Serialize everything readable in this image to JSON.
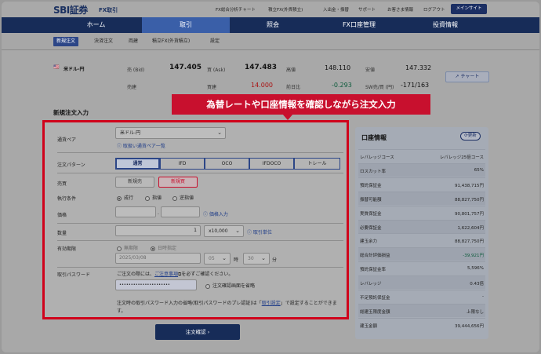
{
  "header": {
    "logo": "SBI証券",
    "logo_sub": "FX取引",
    "links": [
      "FX総合分析チャート",
      "積立FX(外貨積立)",
      "入出金・振替",
      "サポート",
      "お客さま情報",
      "ログアウト"
    ],
    "mainsite": "メインサイト"
  },
  "nav": {
    "items": [
      "ホーム",
      "取引",
      "照会",
      "FX口座管理",
      "投資情報"
    ],
    "active": "取引"
  },
  "subnav": {
    "items": [
      "新規注文",
      "決済注文",
      "両建",
      "積立FX(外貨積立)",
      "設定"
    ],
    "active": "新規注文"
  },
  "rates": {
    "pair": "米ドル-円",
    "bid_label": "売 (Bid)",
    "bid": "147.405",
    "ask_label": "買 (Ask)",
    "ask": "147.483",
    "high_label": "高値",
    "high": "148.110",
    "low_label": "安値",
    "low": "147.332",
    "sell_swap_label": "売建",
    "buy_swap_label": "買建",
    "buy_swap": "14.000",
    "prev_label": "前日比",
    "prev": "-0.293",
    "sw_label": "SW売/買 (円)",
    "sw": "-171/163",
    "chart_button": "チャート"
  },
  "section_title": "新規注文入力",
  "callout": "為替レートや口座情報を確認しながら注文入力",
  "form": {
    "pair_label": "通貨ペア",
    "pair_value": "米ドル-円",
    "pair_list_link": "取扱い通貨ペア一覧",
    "pattern_label": "注文パターン",
    "patterns": [
      "通常",
      "IFD",
      "OCO",
      "IFDOCO",
      "トレール"
    ],
    "side_label": "売買",
    "sell": "新規売",
    "buy": "新規買",
    "exec_label": "執行条件",
    "exec_options": [
      "成行",
      "指値",
      "逆指値"
    ],
    "price_label": "価格",
    "price_sep": ".",
    "price_input_link": "価格入力",
    "qty_label": "数量",
    "qty_value": "1",
    "qty_unit": "x10,000",
    "qty_unit_link": "取引単位",
    "expiry_label": "有効期限",
    "expiry_options": [
      "無期限",
      "日時指定"
    ],
    "expiry_date": "2025/03/08",
    "expiry_hour": "05",
    "hour_label": "時",
    "expiry_min": "30",
    "min_label": "分",
    "password_label": "取引パスワード",
    "notice_prefix": "ご注文の際には、",
    "notice_link": "ご注意事項",
    "notice_suffix": "を必ずご確認ください。",
    "password_value": "••••••••••••••••••••••",
    "skip_confirm": "注文確認画面を省略",
    "bottom_note_1": "注文時の取引パスワード入力の省略(取引パスワードのプレ認証)は「",
    "bottom_note_link": "取引設定",
    "bottom_note_2": "」で設定することができま",
    "bottom_note_3": "す。"
  },
  "confirm_button": "注文確認",
  "account": {
    "title": "口座情報",
    "refresh": "更新",
    "rows": [
      {
        "k": "レバレッジコース",
        "v": "レバレッジ25倍コース"
      },
      {
        "k": "ロスカット率",
        "v": "65%"
      },
      {
        "k": "預託保証金",
        "v": "91,438,715円"
      },
      {
        "k": "振替可能額",
        "v": "88,827,750円"
      },
      {
        "k": "実質保証金",
        "v": "90,801,757円"
      },
      {
        "k": "必要保証金",
        "v": "1,622,604円"
      },
      {
        "k": "建玉余力",
        "v": "88,827,750円"
      },
      {
        "k": "総合計評価損益",
        "v": "-39,921円"
      },
      {
        "k": "預託保証金率",
        "v": "5,596%"
      },
      {
        "k": "レバレッジ",
        "v": "0.43倍"
      },
      {
        "k": "不足預託保証金",
        "v": "-"
      },
      {
        "k": "総建玉限度金額",
        "v": "上限なし"
      },
      {
        "k": "建玉金額",
        "v": "39,444,656円"
      }
    ]
  },
  "colors": {
    "navy": "#172c58",
    "callout_red": "#c8102e",
    "profit_green": "#0a5a3a"
  }
}
